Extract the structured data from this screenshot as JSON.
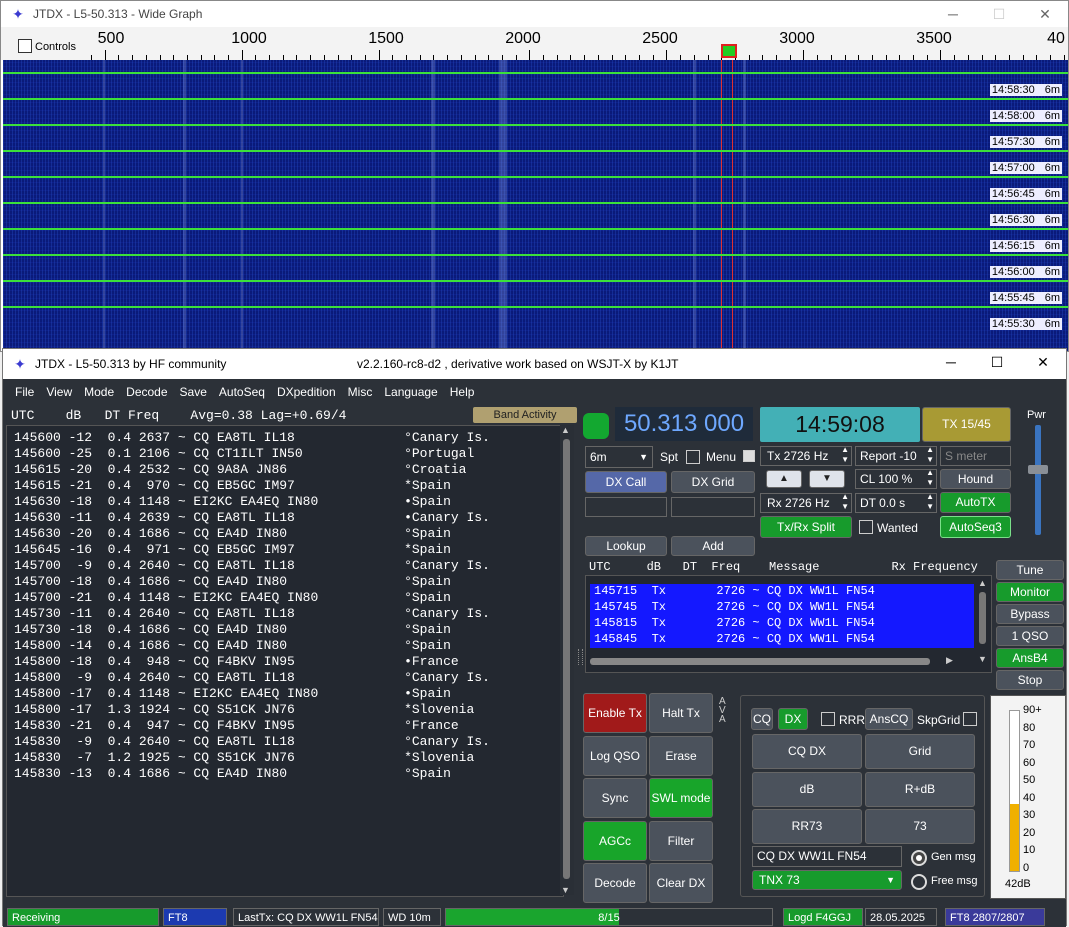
{
  "wide_graph": {
    "title": "JTDX - L5-50.313 - Wide Graph",
    "controls_label": "Controls",
    "scale_labels": [
      "500",
      "1000",
      "1500",
      "2000",
      "2500",
      "3000",
      "3500",
      "40"
    ],
    "times": [
      "14:58:30",
      "14:58:00",
      "14:57:30",
      "14:57:00",
      "14:56:45",
      "14:56:30",
      "14:56:15",
      "14:56:00",
      "14:55:45",
      "14:55:30"
    ],
    "band": "6m"
  },
  "main": {
    "title": "JTDX - L5-50.313  by HF community",
    "subtitle": "v2.2.160-rc8-d2 , derivative work based on WSJT-X by K1JT",
    "menu": [
      "File",
      "View",
      "Mode",
      "Decode",
      "Save",
      "AutoSeq",
      "DXpedition",
      "Misc",
      "Language",
      "Help"
    ],
    "decode_header": "UTC    dB   DT Freq    Avg=0.38 Lag=+0.69/4",
    "band_activity": "Band Activity",
    "decodes": [
      "145600 -12  0.4 2637 ~ CQ EA8TL IL18              °Canary Is.",
      "145600 -25  0.1 2106 ~ CQ CT1ILT IN50             °Portugal",
      "145615 -20  0.4 2532 ~ CQ 9A8A JN86               °Croatia",
      "145615 -21  0.4  970 ~ CQ EB5GC IM97              *Spain",
      "145630 -18  0.4 1148 ~ EI2KC EA4EQ IN80           •Spain",
      "145630 -11  0.4 2639 ~ CQ EA8TL IL18              •Canary Is.",
      "145630 -20  0.4 1686 ~ CQ EA4D IN80               °Spain",
      "145645 -16  0.4  971 ~ CQ EB5GC IM97              *Spain",
      "145700  -9  0.4 2640 ~ CQ EA8TL IL18              °Canary Is.",
      "145700 -18  0.4 1686 ~ CQ EA4D IN80               °Spain",
      "145700 -21  0.4 1148 ~ EI2KC EA4EQ IN80           °Spain",
      "145730 -11  0.4 2640 ~ CQ EA8TL IL18              °Canary Is.",
      "145730 -18  0.4 1686 ~ CQ EA4D IN80               °Spain",
      "145800 -14  0.4 1686 ~ CQ EA4D IN80               °Spain",
      "145800 -18  0.4  948 ~ CQ F4BKV IN95              •France",
      "145800  -9  0.4 2640 ~ CQ EA8TL IL18              °Canary Is.",
      "145800 -17  0.4 1148 ~ EI2KC EA4EQ IN80           •Spain",
      "145800 -17  1.3 1924 ~ CQ S51CK JN76              *Slovenia",
      "145830 -21  0.4  947 ~ CQ F4BKV IN95              °France",
      "145830  -9  0.4 2640 ~ CQ EA8TL IL18              °Canary Is.",
      "145830  -7  1.2 1925 ~ CQ S51CK JN76              *Slovenia",
      "145830 -13  0.4 1686 ~ CQ EA4D IN80               °Spain"
    ],
    "frequency": "50.313 000",
    "clock": "14:59:08",
    "tx_period": "TX 15/45",
    "pwr_label": "Pwr",
    "band_select": "6m",
    "spt": "Spt",
    "menu_cb": "Menu",
    "tx_freq": "Tx  2726 Hz",
    "rx_freq": "Rx  2726 Hz",
    "report": "Report -10",
    "smeter": "S meter",
    "cl": "CL  100 %",
    "dt": "DT 0.0 s",
    "hound": "Hound",
    "autotx": "AutoTX",
    "autoseq": "AutoSeq3",
    "wanted": "Wanted",
    "txrx_split": "Tx/Rx Split",
    "dx_call": "DX Call",
    "dx_grid": "DX Grid",
    "lookup": "Lookup",
    "add": "Add",
    "tx_header": "UTC     dB   DT  Freq    Message          Rx Frequency",
    "tx_lines": [
      "145715  Tx       2726 ~ CQ DX WW1L FN54",
      "145745  Tx       2726 ~ CQ DX WW1L FN54",
      "145815  Tx       2726 ~ CQ DX WW1L FN54",
      "145845  Tx       2726 ~ CQ DX WW1L FN54"
    ],
    "right_buttons": [
      "Tune",
      "Monitor",
      "Bypass",
      "1 QSO",
      "AnsB4",
      "Stop"
    ],
    "left_grid": [
      "Enable Tx",
      "Halt Tx",
      "Log QSO",
      "Erase",
      "Sync",
      "SWL mode",
      "AGCc",
      "Filter",
      "Decode",
      "Clear DX"
    ],
    "cq": "CQ",
    "dx": "DX",
    "rrr": "RRR",
    "anscq": "AnsCQ",
    "skpgrid": "SkpGrid",
    "msg_buttons": [
      "CQ DX",
      "Grid",
      "dB",
      "R+dB",
      "RR73",
      "73"
    ],
    "gen_text": "CQ DX WW1L FN54",
    "tnx": "TNX 73",
    "gen_msg": "Gen msg",
    "free_msg": "Free msg",
    "meter_labels": [
      "90+",
      "80",
      "70",
      "60",
      "50",
      "40",
      "30",
      "20",
      "10",
      "0"
    ],
    "meter_value": "42dB",
    "meter_level": 0.42
  },
  "status": {
    "receiving": "Receiving",
    "mode": "FT8",
    "last_tx": "LastTx: CQ DX WW1L FN54",
    "wd": "WD 10m",
    "progress": "8/15",
    "progress_value": 0.53,
    "logd": "Logd F4GGJ",
    "date": "28.05.2025",
    "ft8count": "FT8  2807/2807"
  }
}
